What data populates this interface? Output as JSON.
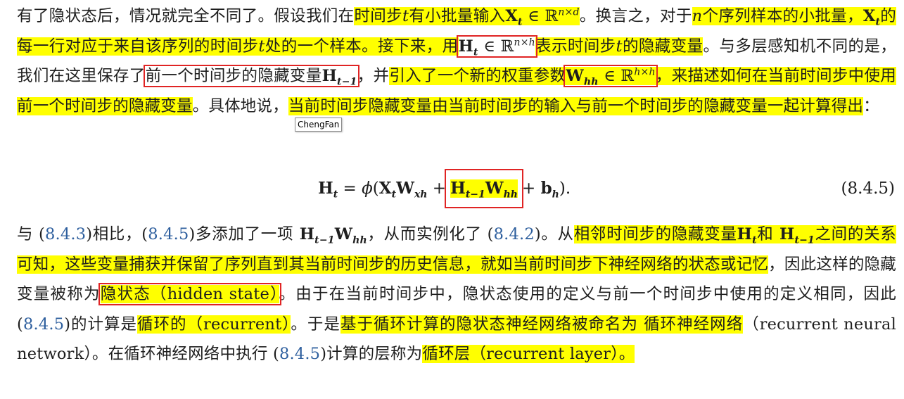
{
  "p1": {
    "s01": "有了隐状态后，情况就完全不同了。假设我们在",
    "s02": "时间步",
    "s03": "有小批量输入",
    "s04": "。换言之，对于",
    "s05": "个序列样本的小批量，",
    "s06": "的每一行对应于来自该序列的时间步",
    "s07": "处的一个样本。接下来，用",
    "s08": "表示时间步",
    "s09": "的隐藏变量",
    "s10": "。与多层感知机不同的是，我们在这里保存了",
    "s11": "前一个时间步的隐藏变量",
    "s12": "，并",
    "s13": "引入了一个新的权重参数",
    "s14": "，来描述如何在",
    "s15": "当前时间步中使用前一个时间步的隐藏变量",
    "s16": "。具体地说，",
    "s17": "当前时间步隐藏变量由当前时间步的输入与前一个时间步的隐藏变量一起计算得出",
    "s18": "："
  },
  "tooltip": "ChengFan",
  "equation": {
    "number": "(8.4.5)"
  },
  "p2": {
    "s01": "与 (",
    "ref1": "8.4.3",
    "s02": ")相比，(",
    "ref2": "8.4.5",
    "s03": ")多添加了一项",
    "s04": "，从而实例化了 (",
    "ref3": "8.4.2",
    "s05": ")。从",
    "s06": "相邻时间步的隐藏变量",
    "s07": "和",
    "s08": "之间的关系可知，",
    "s09": "这些变量捕获并保留了序列直到其当前时间步的历史信息，就如当前时间步下神经网络的状态或记忆",
    "s10": "，因此这样的隐藏变量被称为",
    "s11": "隐状态（hidden state）",
    "s12": "。由于在当前时间步中，隐状态使用的定义与前一个时间步中使用的定义相同，因此 (",
    "ref4": "8.4.5",
    "s13": ")的计算是",
    "s14": "循环的（recurrent）",
    "s15": "。于是",
    "s16": "基于循环计算的隐状态神经网络被命名为 循环神经网络",
    "s17": "（recurrent neural network）。在循环神经网络中执行 (",
    "ref5": "8.4.5",
    "s18": ")计算的层称为",
    "s19": "循环层（recurrent layer）。"
  }
}
